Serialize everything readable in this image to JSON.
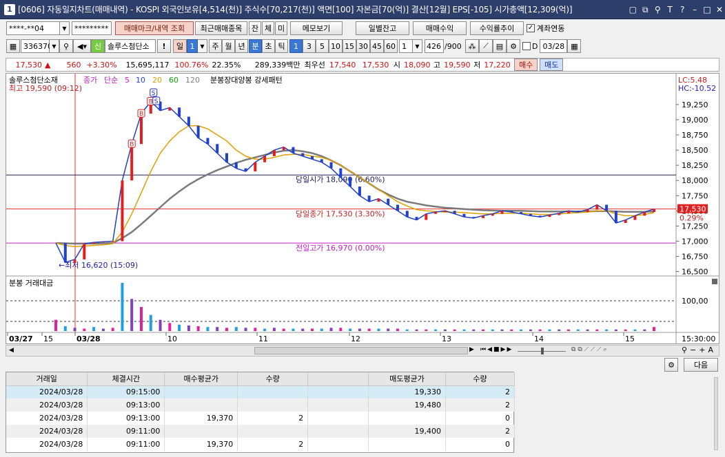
{
  "window": {
    "title": "[0606] 자동일지차트(매매내역) - KOSPI 외국인보유[4,514(천)] 주식수[70,217(천)] 액면[100] 자본금[70(억)] 결산[12월] EPS[-105] 시가총액[12,309(억)]",
    "app_icon": "1",
    "icons": [
      "window-icon",
      "help-icon",
      "minimize-icon",
      "maximize-icon",
      "close-icon"
    ],
    "buttons": [
      "▢",
      "⧉",
      "⚲",
      "T",
      "?",
      "–",
      "□",
      "✕"
    ]
  },
  "row1": {
    "account": "****-**04",
    "password": "*********",
    "view_trades_button": "매매마크/내역 조회",
    "recent_trades_button": "최근매매종목",
    "balance_button": "잔",
    "fill_button": "체",
    "unfilled_button": "미",
    "memo_button": "메모보기",
    "daily_balance_button": "일별잔고",
    "trade_profit_button": "매매수익",
    "return_trend_button": "수익률추이",
    "link_account_label": "계좌연동",
    "link_account_checked": true
  },
  "row2": {
    "code": "336370",
    "credit_label": "신",
    "stock_name": "솔루스첨단소",
    "warn_label": "!",
    "period_day": "일",
    "period_value": "1",
    "periods": [
      "주",
      "월",
      "년"
    ],
    "minute_label": "분",
    "second_label": "초",
    "tick_label": "틱",
    "intervals": [
      "1",
      "3",
      "5",
      "10",
      "15",
      "30",
      "45",
      "60"
    ],
    "interval_custom": "1",
    "count_value": "426",
    "count_total": "/900",
    "checkbox_label": "D",
    "date_value": "03/28"
  },
  "quote": {
    "price": "17,530",
    "change_arrow": "▲",
    "change": "560",
    "change_pct": "+3.30%",
    "volume": "15,695,117",
    "volume_ratio": "100.76%",
    "turnover": "22.35%",
    "amount": "289,339백만",
    "best_ask_label": "최우선",
    "best_ask": "17,540",
    "best_bid": "17,530",
    "open_label": "시",
    "open": "18,090",
    "high_label": "고",
    "high": "19,590",
    "low_label": "저",
    "low": "17,220",
    "buy_button": "매수",
    "sell_button": "매도"
  },
  "chart_data": {
    "type": "line",
    "legend": {
      "name": "솔루스첨단소재",
      "price_label": "종가",
      "ma_label": "단순",
      "periods": [
        "5",
        "10",
        "20",
        "60",
        "120"
      ],
      "period_colors": [
        "#d020d0",
        "#2040e0",
        "#e0a000",
        "#10a010",
        "#808080"
      ],
      "pattern": "분봉장대양봉 강세패턴"
    },
    "top_left_annotation": "최고 19,590 (09:12)",
    "lc_label": "LC:5.48",
    "hc_label": "HC:-10.52",
    "y_ticks": [
      "19,250",
      "19,000",
      "18,750",
      "18,500",
      "18,250",
      "18,000",
      "17,750",
      "17,500",
      "17,250",
      "17,000",
      "16,750",
      "16,500"
    ],
    "ylim": [
      16450,
      19600
    ],
    "annotations": {
      "open_today": "당일시가 18,090 (6.60%)",
      "close_today": "당일종가 17,530 (3.30%)",
      "prev_high": "전일고가 16,970 (0.00%)",
      "low_mark": "최저 16,620 (15:09)"
    },
    "last_price_tag": "17,530",
    "last_price_pct": "0.29%",
    "lines": {
      "open_today": 18090,
      "close_today": 17530,
      "prev_high": 16970
    },
    "trade_marks": [
      "B",
      "B",
      "B",
      "S",
      "S"
    ],
    "x_labels": [
      "03/27",
      "15",
      "03/28",
      "10",
      "11",
      "12",
      "13",
      "14",
      "15"
    ],
    "time_label": "15:30:00",
    "prices": [
      16970,
      16650,
      16700,
      16960,
      16980,
      16990,
      17000,
      18000,
      18600,
      19100,
      19300,
      19150,
      19200,
      19050,
      18900,
      18700,
      18600,
      18450,
      18300,
      18200,
      18150,
      18300,
      18400,
      18500,
      18550,
      18450,
      18400,
      18350,
      18300,
      18200,
      18050,
      17900,
      17750,
      17650,
      17700,
      17600,
      17500,
      17400,
      17350,
      17450,
      17480,
      17500,
      17450,
      17400,
      17380,
      17420,
      17450,
      17500,
      17480,
      17450,
      17420,
      17400,
      17430,
      17460,
      17500,
      17480,
      17520,
      17600,
      17500,
      17300,
      17350,
      17420,
      17480,
      17530
    ],
    "ma20": [
      16970,
      16930,
      16910,
      16920,
      16930,
      16940,
      16960,
      17150,
      17450,
      17800,
      18150,
      18450,
      18650,
      18800,
      18900,
      18900,
      18850,
      18750,
      18650,
      18500,
      18400,
      18350,
      18350,
      18380,
      18420,
      18430,
      18430,
      18400,
      18380,
      18330,
      18250,
      18150,
      18050,
      17950,
      17850,
      17750,
      17650,
      17580,
      17520,
      17500,
      17490,
      17480,
      17480,
      17470,
      17460,
      17450,
      17450,
      17460,
      17460,
      17460,
      17450,
      17440,
      17440,
      17450,
      17460,
      17470,
      17480,
      17500,
      17500,
      17450,
      17420,
      17420,
      17440,
      17470
    ],
    "ma120": [
      16970,
      16965,
      16960,
      16960,
      16960,
      16965,
      16970,
      17050,
      17150,
      17280,
      17420,
      17560,
      17700,
      17820,
      17930,
      18020,
      18100,
      18170,
      18230,
      18290,
      18340,
      18380,
      18420,
      18460,
      18490,
      18500,
      18480,
      18450,
      18400,
      18330,
      18250,
      18150,
      18050,
      17950,
      17850,
      17770,
      17700,
      17650,
      17620,
      17590,
      17570,
      17550,
      17540,
      17530,
      17520,
      17510,
      17505,
      17500,
      17500,
      17500,
      17495,
      17490,
      17490,
      17490,
      17490,
      17490,
      17490,
      17495,
      17495,
      17490,
      17485,
      17485,
      17485,
      17490
    ],
    "volume_panel": {
      "title": "분봉 거래대금",
      "y_tick": "100,00",
      "volumes": [
        14,
        6,
        4,
        3,
        5,
        3,
        4,
        60,
        40,
        30,
        20,
        14,
        10,
        8,
        7,
        6,
        5,
        5,
        4,
        5,
        4,
        4,
        3,
        4,
        3,
        3,
        3,
        3,
        3,
        4,
        4,
        3,
        3,
        3,
        3,
        3,
        3,
        2,
        2,
        2,
        2,
        2,
        2,
        2,
        2,
        2,
        2,
        2,
        2,
        2,
        2,
        2,
        2,
        2,
        2,
        2,
        2,
        2,
        2,
        2,
        2,
        2,
        2,
        5
      ]
    }
  },
  "nav": {
    "next_button": "다음"
  },
  "trades": {
    "headers": [
      "거래일",
      "체결시간",
      "매수평균가",
      "수량",
      "",
      "매도평균가",
      "수량"
    ],
    "rows": [
      {
        "date": "2024/03/28",
        "time": "09:15:00",
        "buy_avg": "",
        "buy_qty": "",
        "blank": "",
        "sell_avg": "19,330",
        "sell_qty": "2"
      },
      {
        "date": "2024/03/28",
        "time": "09:13:00",
        "buy_avg": "",
        "buy_qty": "",
        "blank": "",
        "sell_avg": "19,480",
        "sell_qty": "2"
      },
      {
        "date": "2024/03/28",
        "time": "09:13:00",
        "buy_avg": "19,370",
        "buy_qty": "2",
        "blank": "",
        "sell_avg": "",
        "sell_qty": "0"
      },
      {
        "date": "2024/03/28",
        "time": "09:11:00",
        "buy_avg": "",
        "buy_qty": "",
        "blank": "",
        "sell_avg": "19,400",
        "sell_qty": "2"
      },
      {
        "date": "2024/03/28",
        "time": "09:11:00",
        "buy_avg": "19,370",
        "buy_qty": "2",
        "blank": "",
        "sell_avg": "",
        "sell_qty": "0"
      }
    ]
  }
}
